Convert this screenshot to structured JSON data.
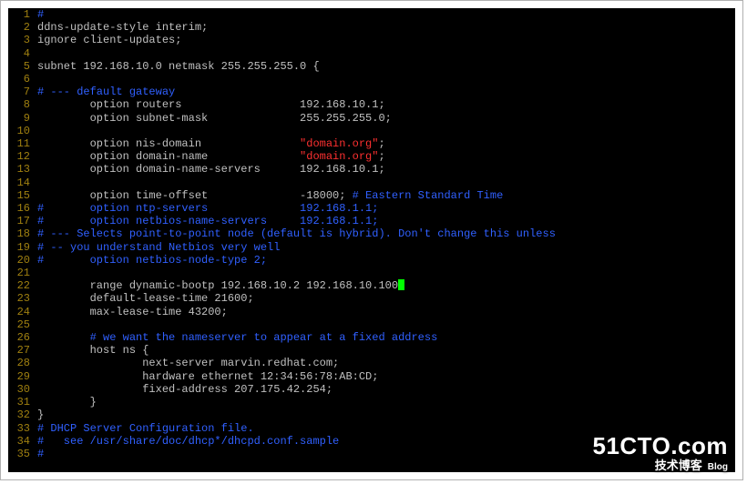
{
  "watermark": {
    "domain": "51CTO.com",
    "tagline": "技术博客",
    "blog": "Blog"
  },
  "editor": {
    "lines": [
      {
        "no": 1,
        "segments": [
          {
            "cls": "comment",
            "text": "#"
          }
        ]
      },
      {
        "no": 2,
        "segments": [
          {
            "cls": "kw",
            "text": "ddns-update-style interim;"
          }
        ]
      },
      {
        "no": 3,
        "segments": [
          {
            "cls": "kw",
            "text": "ignore client-updates;"
          }
        ]
      },
      {
        "no": 4,
        "segments": []
      },
      {
        "no": 5,
        "segments": [
          {
            "cls": "kw",
            "text": "subnet 192.168.10.0 netmask 255.255.255.0 {"
          }
        ]
      },
      {
        "no": 6,
        "segments": []
      },
      {
        "no": 7,
        "segments": [
          {
            "cls": "comment",
            "text": "# --- default gateway"
          }
        ]
      },
      {
        "no": 8,
        "segments": [
          {
            "cls": "kw",
            "text": "        option routers                  192.168.10.1;"
          }
        ]
      },
      {
        "no": 9,
        "segments": [
          {
            "cls": "kw",
            "text": "        option subnet-mask              255.255.255.0;"
          }
        ]
      },
      {
        "no": 10,
        "segments": []
      },
      {
        "no": 11,
        "segments": [
          {
            "cls": "kw",
            "text": "        option nis-domain               "
          },
          {
            "cls": "str",
            "text": "\"domain.org\""
          },
          {
            "cls": "kw",
            "text": ";"
          }
        ]
      },
      {
        "no": 12,
        "segments": [
          {
            "cls": "kw",
            "text": "        option domain-name              "
          },
          {
            "cls": "str",
            "text": "\"domain.org\""
          },
          {
            "cls": "kw",
            "text": ";"
          }
        ]
      },
      {
        "no": 13,
        "segments": [
          {
            "cls": "kw",
            "text": "        option domain-name-servers      192.168.10.1;"
          }
        ]
      },
      {
        "no": 14,
        "segments": []
      },
      {
        "no": 15,
        "segments": [
          {
            "cls": "kw",
            "text": "        option time-offset              -18000; "
          },
          {
            "cls": "comment",
            "text": "# Eastern Standard Time"
          }
        ]
      },
      {
        "no": 16,
        "segments": [
          {
            "cls": "comment",
            "text": "#       option ntp-servers              192.168.1.1;"
          }
        ]
      },
      {
        "no": 17,
        "segments": [
          {
            "cls": "comment",
            "text": "#       option netbios-name-servers     192.168.1.1;"
          }
        ]
      },
      {
        "no": 18,
        "segments": [
          {
            "cls": "comment",
            "text": "# --- Selects point-to-point node (default is hybrid). Don't change this unless"
          }
        ]
      },
      {
        "no": 19,
        "segments": [
          {
            "cls": "comment",
            "text": "# -- you understand Netbios very well"
          }
        ]
      },
      {
        "no": 20,
        "segments": [
          {
            "cls": "comment",
            "text": "#       option netbios-node-type 2;"
          }
        ]
      },
      {
        "no": 21,
        "segments": []
      },
      {
        "no": 22,
        "segments": [
          {
            "cls": "kw",
            "text": "        range dynamic-bootp 192.168.10.2 192.168.10.100"
          },
          {
            "cls": "cursor",
            "text": ""
          }
        ]
      },
      {
        "no": 23,
        "segments": [
          {
            "cls": "kw",
            "text": "        default-lease-time 21600;"
          }
        ]
      },
      {
        "no": 24,
        "segments": [
          {
            "cls": "kw",
            "text": "        max-lease-time 43200;"
          }
        ]
      },
      {
        "no": 25,
        "segments": []
      },
      {
        "no": 26,
        "segments": [
          {
            "cls": "kw",
            "text": "        "
          },
          {
            "cls": "comment",
            "text": "# we want the nameserver to appear at a fixed address"
          }
        ]
      },
      {
        "no": 27,
        "segments": [
          {
            "cls": "kw",
            "text": "        host ns {"
          }
        ]
      },
      {
        "no": 28,
        "segments": [
          {
            "cls": "kw",
            "text": "                next-server marvin.redhat.com;"
          }
        ]
      },
      {
        "no": 29,
        "segments": [
          {
            "cls": "kw",
            "text": "                hardware ethernet 12:34:56:78:AB:CD;"
          }
        ]
      },
      {
        "no": 30,
        "segments": [
          {
            "cls": "kw",
            "text": "                fixed-address 207.175.42.254;"
          }
        ]
      },
      {
        "no": 31,
        "segments": [
          {
            "cls": "kw",
            "text": "        }"
          }
        ]
      },
      {
        "no": 32,
        "segments": [
          {
            "cls": "kw",
            "text": "}"
          }
        ]
      },
      {
        "no": 33,
        "segments": [
          {
            "cls": "comment",
            "text": "# DHCP Server Configuration file."
          }
        ]
      },
      {
        "no": 34,
        "segments": [
          {
            "cls": "comment",
            "text": "#   see /usr/share/doc/dhcp*/dhcpd.conf.sample"
          }
        ]
      },
      {
        "no": 35,
        "segments": [
          {
            "cls": "comment",
            "text": "#"
          }
        ]
      }
    ]
  }
}
